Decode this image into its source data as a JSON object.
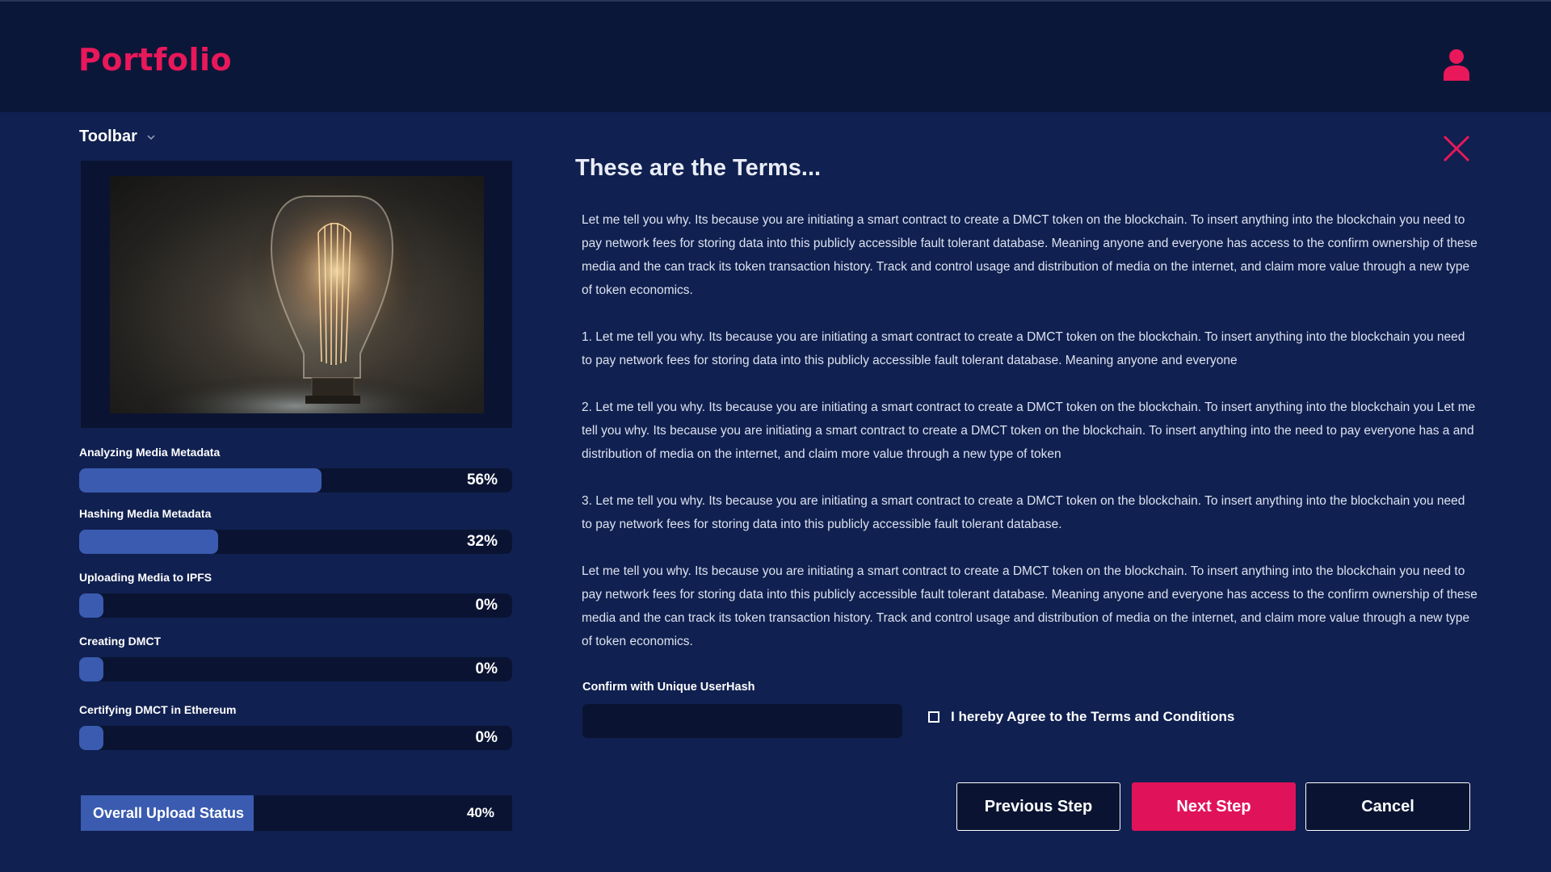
{
  "header": {
    "logo": "Portfolio",
    "brand_color": "#e8185a",
    "user_icon": "user-icon"
  },
  "sidebar": {
    "toolbar_label": "Toolbar",
    "media_image": "light-bulb-photo",
    "progress": [
      {
        "label": "Analyzing Media Metadata",
        "value": 56,
        "display": "56%"
      },
      {
        "label": "Hashing Media Metadata",
        "value": 32,
        "display": "32%"
      },
      {
        "label": "Uploading Media to IPFS",
        "value": 0,
        "display": "0%"
      },
      {
        "label": "Creating DMCT",
        "value": 0,
        "display": "0%"
      },
      {
        "label": "Certifying DMCT in Ethereum",
        "value": 0,
        "display": "0%"
      }
    ],
    "overall": {
      "label": "Overall Upload Status",
      "value": 40,
      "display": "40%"
    }
  },
  "terms": {
    "title": "These are the Terms...",
    "paragraphs": [
      "Let me tell you why. Its because you are initiating a smart contract to create a DMCT token on the blockchain. To insert anything into the blockchain you need to pay network fees for storing data into this publicly accessible fault tolerant database. Meaning anyone and everyone has access to the confirm ownership of these media and the can track its token transaction history.  Track and control usage and distribution of media on the internet, and claim more value through a new type of token economics.",
      "1. Let me tell you why. Its because you are initiating a smart contract to create a DMCT token on the blockchain. To insert anything into the blockchain you need to pay network fees for storing data into this publicly accessible fault tolerant database. Meaning anyone and everyone",
      "2. Let me tell you why. Its because you are initiating a smart contract to create a DMCT token on the blockchain. To insert anything into the blockchain you Let me tell you why. Its because you are initiating a smart contract to create a DMCT token on the blockchain. To insert anything into the need to pay everyone has a and distribution of media on the internet, and claim more value through a new type of token",
      "3. Let me tell you why. Its because you are initiating a smart contract to create a DMCT token on the blockchain. To insert anything into the blockchain you need to pay network fees for storing data into this publicly accessible fault tolerant database.",
      "Let me tell you why. Its because you are initiating a smart contract to create a DMCT token on the blockchain. To insert anything into the blockchain you need to pay network fees for storing data into this publicly accessible fault tolerant database. Meaning anyone and everyone has access to the confirm ownership of these media and the can track its token transaction history.  Track and control usage and distribution of media on the internet, and claim more value through a new type of token economics."
    ],
    "hash_label": "Confirm with Unique UserHash",
    "hash_value": "",
    "agree_label": "I hereby Agree to the Terms and Conditions",
    "agree_checked": false
  },
  "buttons": {
    "previous": "Previous Step",
    "next": "Next Step",
    "cancel": "Cancel"
  },
  "colors": {
    "background": "#102050",
    "header": "#0b1739",
    "panel": "#0a1432",
    "progress_fill": "#3a5bb0",
    "accent": "#e0125a"
  }
}
